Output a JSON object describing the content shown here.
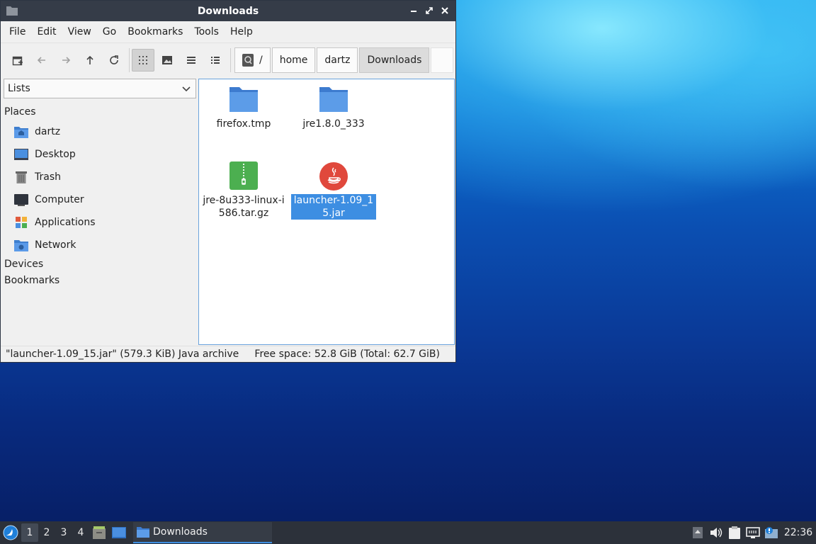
{
  "window": {
    "title": "Downloads"
  },
  "menu": [
    "File",
    "Edit",
    "View",
    "Go",
    "Bookmarks",
    "Tools",
    "Help"
  ],
  "path": {
    "root": "/",
    "crumbs": [
      "home",
      "dartz",
      "Downloads"
    ]
  },
  "sidebar": {
    "mode": "Lists",
    "places_heading": "Places",
    "places": [
      {
        "label": "dartz",
        "icon": "home-folder-icon"
      },
      {
        "label": "Desktop",
        "icon": "desktop-icon"
      },
      {
        "label": "Trash",
        "icon": "trash-icon"
      },
      {
        "label": "Computer",
        "icon": "computer-icon"
      },
      {
        "label": "Applications",
        "icon": "applications-icon"
      },
      {
        "label": "Network",
        "icon": "network-icon"
      }
    ],
    "devices_heading": "Devices",
    "bookmarks_heading": "Bookmarks"
  },
  "files": [
    {
      "name": "firefox.tmp",
      "icon": "folder-icon"
    },
    {
      "name": "jre1.8.0_333",
      "icon": "folder-icon"
    },
    {
      "name": "jre-8u333-linux-i586.tar.gz",
      "icon": "archive-icon"
    },
    {
      "name": "launcher-1.09_15.jar",
      "icon": "java-icon",
      "selected": true
    }
  ],
  "status": {
    "selection": "\"launcher-1.09_15.jar\" (579.3 KiB) Java archive",
    "free_space": "Free space: 52.8 GiB (Total: 62.7 GiB)"
  },
  "panel": {
    "workspaces": [
      "1",
      "2",
      "3",
      "4"
    ],
    "active_workspace": "1",
    "task_label": "Downloads",
    "clock": "22:36"
  },
  "colors": {
    "titlebar": "#353c48",
    "panel": "#2c313a",
    "selection": "#3d8ee2",
    "folder": "#4a8fe0"
  }
}
